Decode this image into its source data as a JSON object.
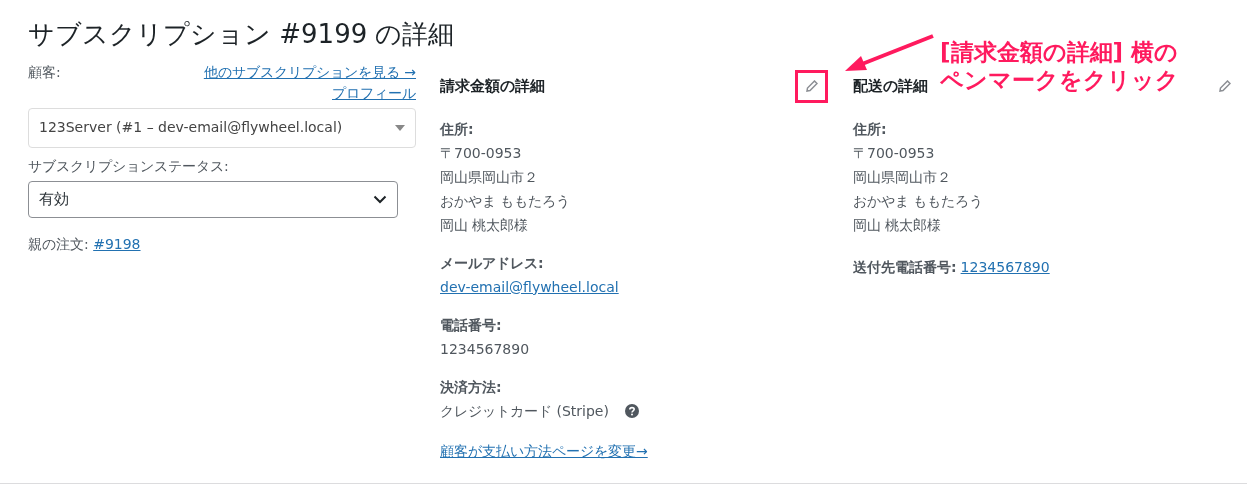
{
  "page_title": "サブスクリプション #9199 の詳細",
  "customer": {
    "label": "顧客:",
    "links": [
      "他のサブスクリプションを見る →",
      "プロフィール"
    ],
    "value": "123Server (#1 – dev-email@flywheel.local)"
  },
  "status": {
    "label": "サブスクリプションステータス:",
    "value": "有効"
  },
  "parent_order": {
    "label": "親の注文:",
    "link": "#9198"
  },
  "billing": {
    "title": "請求金額の詳細",
    "edit_highlighted": true,
    "fields": [
      {
        "label": "住所:",
        "kind": "stacked",
        "values": [
          {
            "kind": "text",
            "text": "〒700-0953"
          },
          {
            "kind": "text",
            "text": "岡山県岡山市２"
          },
          {
            "kind": "text",
            "text": "おかやま ももたろう"
          },
          {
            "kind": "text",
            "text": "岡山 桃太郎様"
          }
        ]
      },
      {
        "label": "メールアドレス:",
        "kind": "stacked",
        "values": [
          {
            "kind": "link",
            "text": "dev-email@flywheel.local"
          }
        ]
      },
      {
        "label": "電話番号:",
        "kind": "stacked",
        "values": [
          {
            "kind": "text",
            "text": "1234567890"
          }
        ]
      },
      {
        "label": "決済方法:",
        "kind": "stacked",
        "help_icon": true,
        "values": [
          {
            "kind": "text",
            "text": "クレジットカード (Stripe)"
          }
        ]
      }
    ],
    "change_link": "顧客が支払い方法ページを変更→"
  },
  "shipping": {
    "title": "配送の詳細",
    "edit_highlighted": false,
    "fields": [
      {
        "label": "住所:",
        "kind": "stacked",
        "values": [
          {
            "kind": "text",
            "text": "〒700-0953"
          },
          {
            "kind": "text",
            "text": "岡山県岡山市２"
          },
          {
            "kind": "text",
            "text": "おかやま ももたろう"
          },
          {
            "kind": "text",
            "text": "岡山 桃太郎様"
          }
        ]
      },
      {
        "label": "送付先電話番号:",
        "kind": "inline",
        "values": [
          {
            "kind": "link",
            "text": "1234567890"
          }
        ]
      }
    ]
  },
  "callout": {
    "lines": [
      "[請求金額の詳細] 横の",
      "ペンマークをクリック"
    ]
  }
}
